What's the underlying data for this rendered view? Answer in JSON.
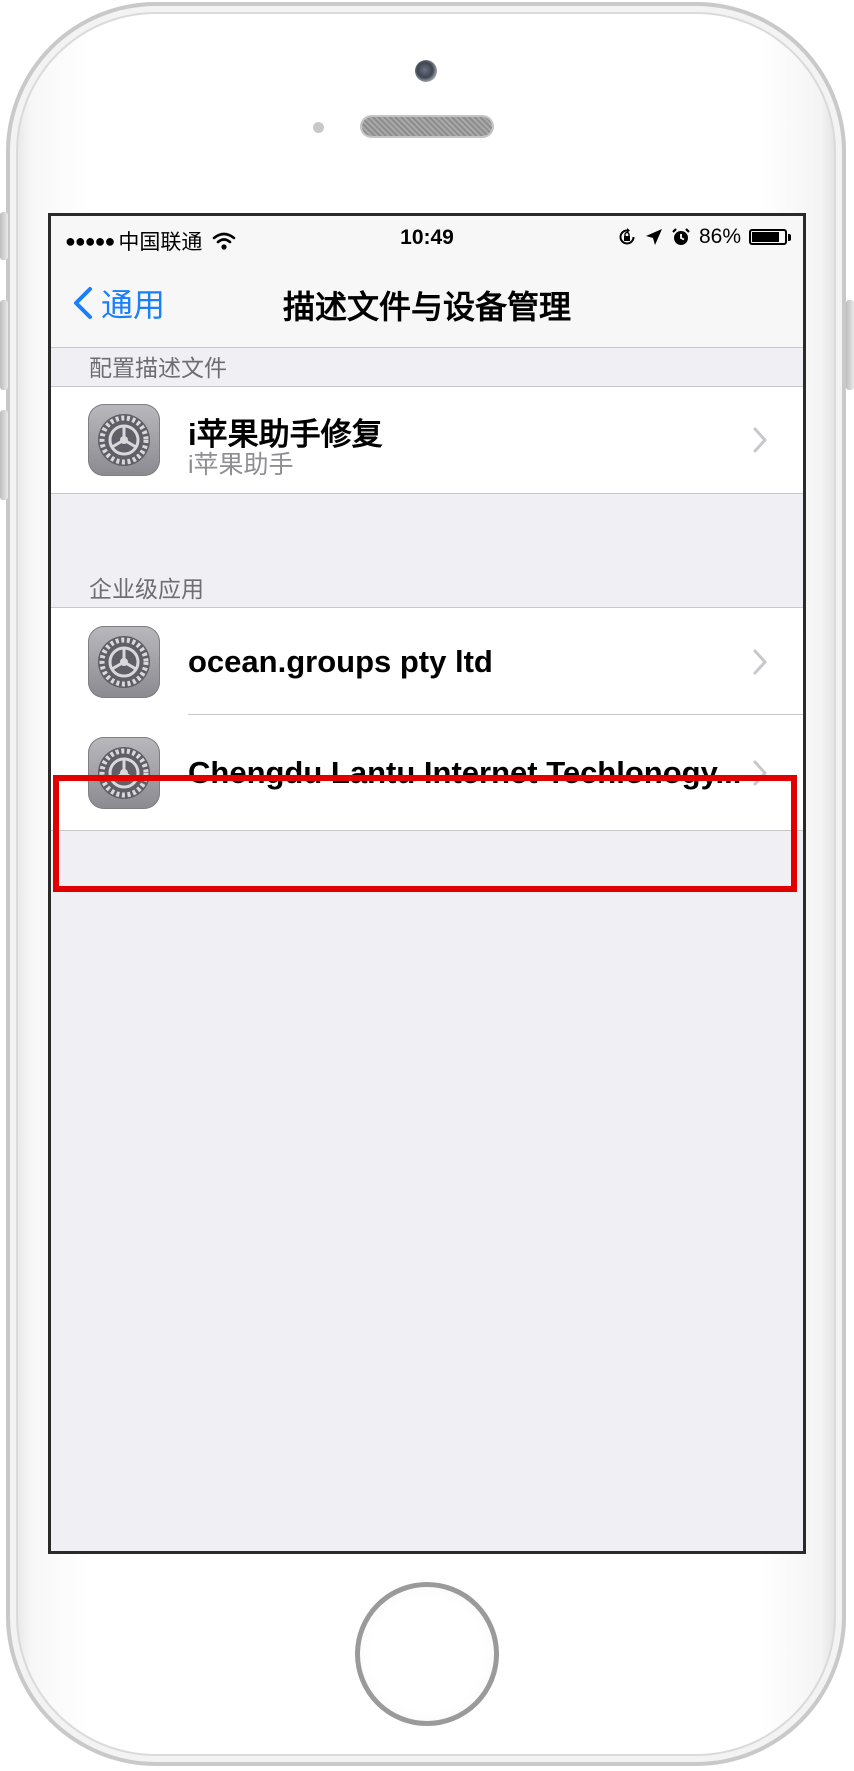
{
  "status_bar": {
    "signal": "●●●●●",
    "carrier": "中国联通",
    "time": "10:49",
    "battery_percent": "86%",
    "battery_level": 0.86
  },
  "nav": {
    "back_label": "通用",
    "title": "描述文件与设备管理"
  },
  "sections": [
    {
      "header": "配置描述文件",
      "items": [
        {
          "title": "i苹果助手修复",
          "subtitle": "i苹果助手",
          "icon": "settings-gear-icon"
        }
      ]
    },
    {
      "header": "企业级应用",
      "items": [
        {
          "title": "ocean.groups pty ltd",
          "icon": "settings-gear-icon"
        },
        {
          "title": "Chengdu Lantu Internet Techlonogy...",
          "icon": "settings-gear-icon"
        }
      ]
    }
  ],
  "colors": {
    "accent": "#1a7ffb",
    "highlight": "#e00000",
    "background": "#efeff4"
  }
}
